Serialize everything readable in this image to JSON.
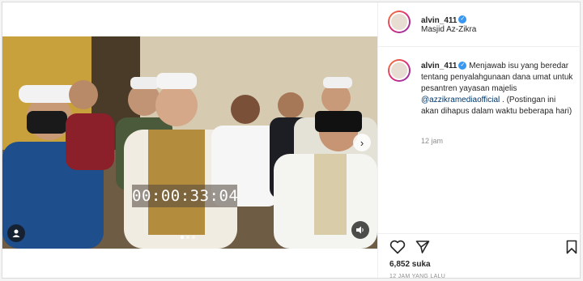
{
  "post": {
    "username": "alvin_411",
    "location": "Masjid Az-Zikra",
    "caption_text": "Menjawab isu yang beredar tentang penyalahgunaan dana umat untuk pesantren yayasan majelis ",
    "caption_mention": "@azzikramediaofficial",
    "caption_tail": " . (Postingan ini akan dihapus dalam waktu beberapa hari)",
    "caption_time": "12 jam",
    "likes": "6,852 suka",
    "posted_ago": "12 JAM YANG LALU"
  },
  "video": {
    "timestamp": "00:00:33:04",
    "carousel_dots": 3,
    "active_dot": 1
  },
  "icons": {
    "verified": "verified-badge-icon",
    "like": "heart-icon",
    "share": "paper-plane-icon",
    "save": "bookmark-icon",
    "next": "chevron-right-icon",
    "tags": "user-tag-icon",
    "audio": "speaker-icon"
  },
  "colors": {
    "verified": "#3897f0",
    "mention": "#00376b",
    "muted": "#8e8e8e"
  }
}
